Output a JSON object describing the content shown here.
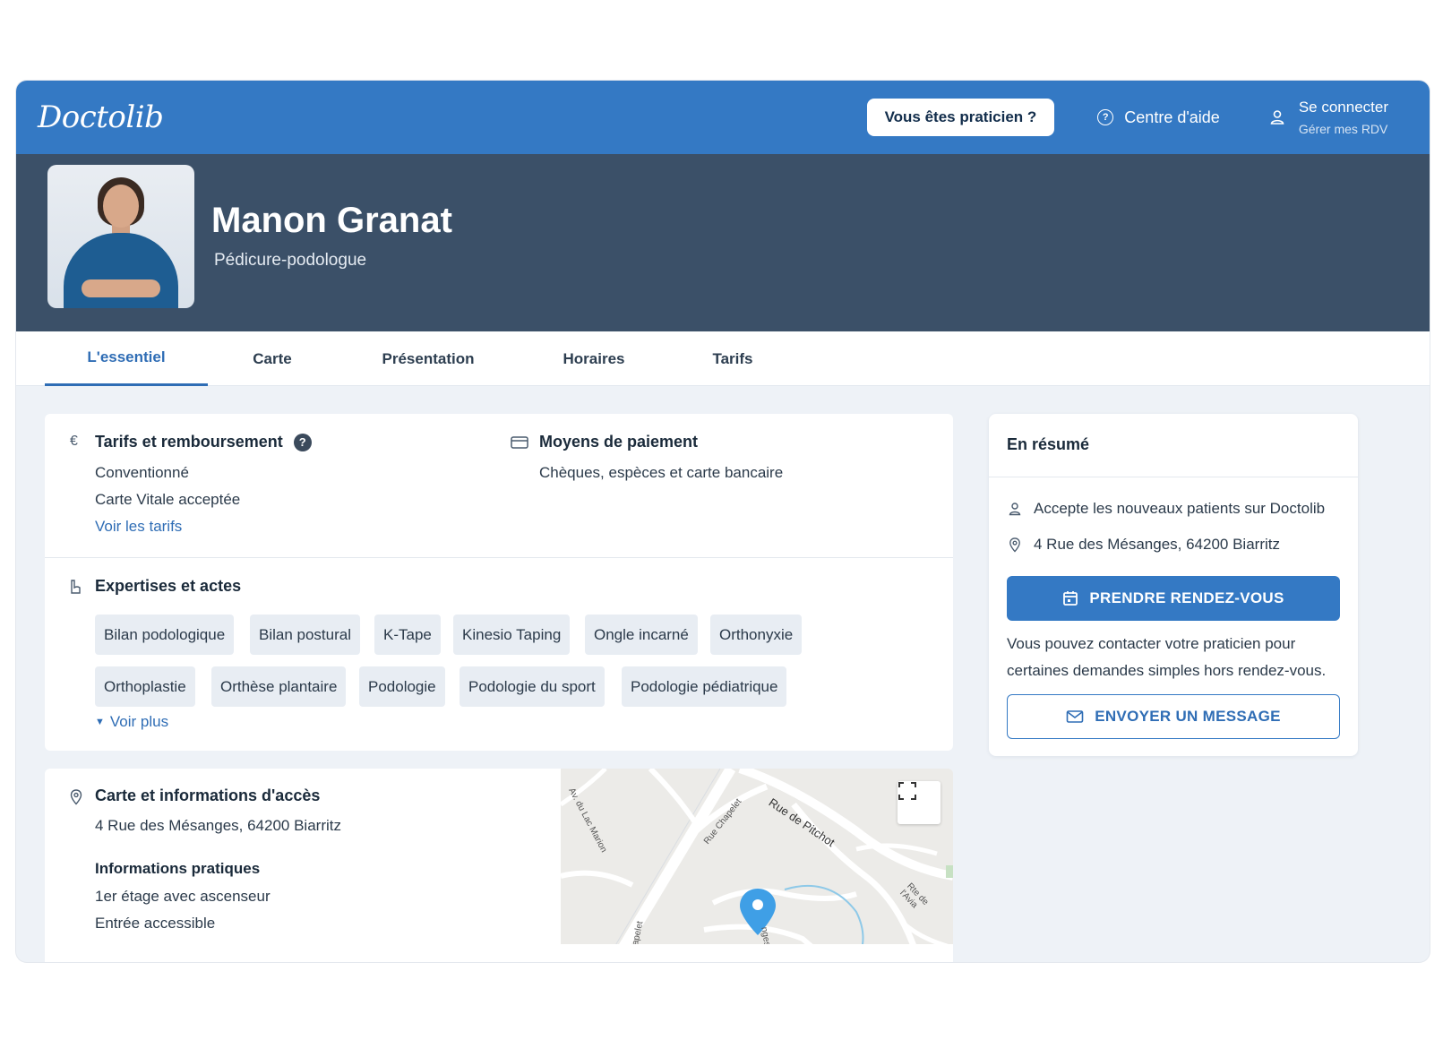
{
  "nav": {
    "logo": "Doctolib",
    "pro_button": "Vous êtes praticien ?",
    "help": "Centre d'aide",
    "login_title": "Se connecter",
    "login_sub": "Gérer mes RDV"
  },
  "profile": {
    "name": "Manon Granat",
    "specialty": "Pédicure-podologue"
  },
  "tabs": [
    "L'essentiel",
    "Carte",
    "Présentation",
    "Horaires",
    "Tarifs"
  ],
  "tarifs": {
    "icon": "€",
    "title": "Tarifs et remboursement",
    "help_mark": "?",
    "lines": [
      "Conventionné",
      "Carte Vitale acceptée"
    ],
    "link": "Voir les tarifs"
  },
  "paiement": {
    "title": "Moyens de paiement",
    "text": "Chèques, espèces et carte bancaire"
  },
  "expertises": {
    "title": "Expertises et actes",
    "chips_row1": [
      "Bilan podologique",
      "Bilan postural",
      "K-Tape",
      "Kinesio Taping",
      "Ongle incarné",
      "Orthonyxie"
    ],
    "chips_row2": [
      "Orthoplastie",
      "Orthèse plantaire",
      "Podologie",
      "Podologie du sport",
      "Podologie pédiatrique"
    ],
    "more": "Voir plus"
  },
  "acces": {
    "title": "Carte et informations d'accès",
    "address": "4 Rue des Mésanges, 64200 Biarritz",
    "practical_title": "Informations pratiques",
    "practical": [
      "1er étage avec ascenseur",
      "Entrée accessible"
    ]
  },
  "map_labels": {
    "street1": "Rue de Pitchot",
    "street2": "Rue Chapelet",
    "street3": "Av. du Lac Marion",
    "street4": "Rte de l'Avia",
    "street5": "apelet",
    "street6": "nges"
  },
  "summary": {
    "title": "En résumé",
    "new_patients": "Accepte les nouveaux patients sur Doctolib",
    "address": "4 Rue des Mésanges, 64200 Biarritz",
    "book_button": "PRENDRE RENDEZ-VOUS",
    "contact_text": "Vous pouvez contacter votre praticien pour certaines demandes simples hors rendez-vous.",
    "message_button": "ENVOYER UN MESSAGE"
  },
  "colors": {
    "brand": "#3479c4",
    "banner": "#3b5068",
    "background": "#eef2f7"
  }
}
